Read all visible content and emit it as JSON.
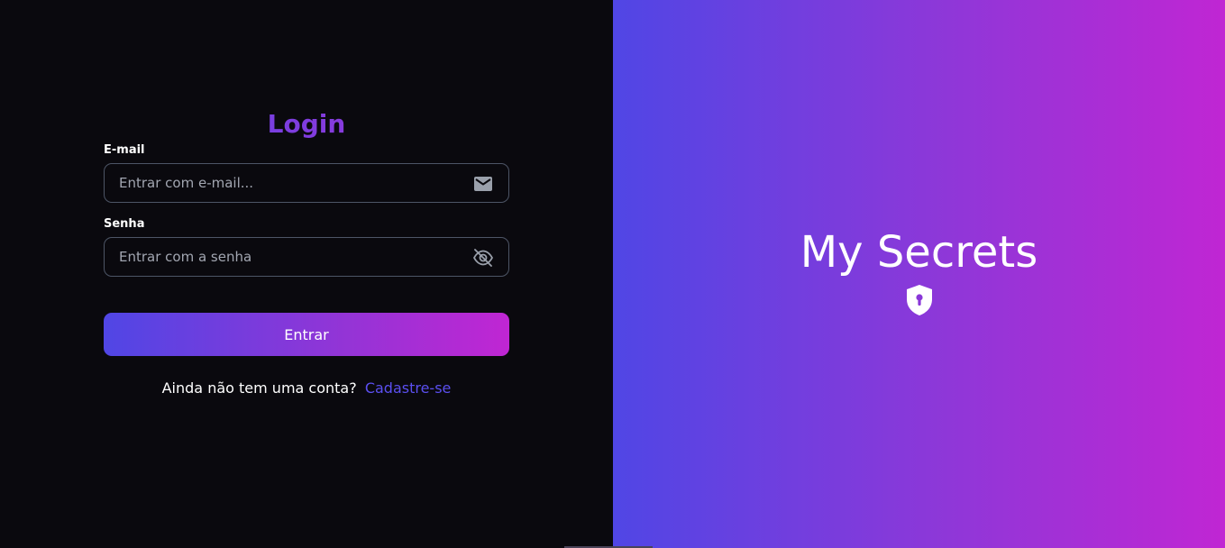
{
  "login": {
    "title": "Login",
    "email": {
      "label": "E-mail",
      "placeholder": "Entrar com e-mail...",
      "value": "",
      "icon": "mail-icon"
    },
    "password": {
      "label": "Senha",
      "placeholder": "Entrar com a senha",
      "value": "",
      "icon": "eye-slash-icon"
    },
    "submit_label": "Entrar",
    "signup_prompt": "Ainda não tem uma conta?",
    "signup_link": "Cadastre-se"
  },
  "brand": {
    "title": "My Secrets",
    "icon": "shield-keyhole-icon"
  },
  "colors": {
    "background": "#0a090e",
    "gradient_start": "#5046e5",
    "gradient_end": "#c026d3",
    "link": "#5b4ff0",
    "input_border": "#4d5566"
  }
}
